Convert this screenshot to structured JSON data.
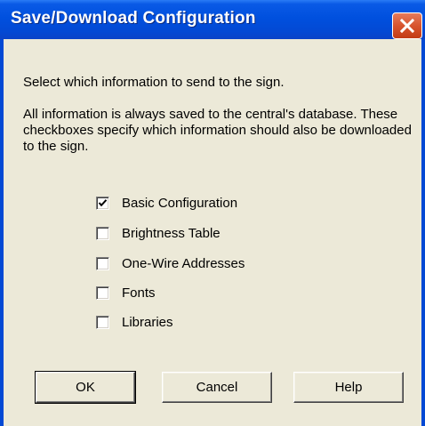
{
  "window": {
    "title": "Save/Download Configuration",
    "close_icon": "close-x-icon",
    "colors": {
      "titlebar": "#0050de",
      "face": "#ece9d8",
      "close": "#d8542e"
    }
  },
  "content": {
    "instruction": "Select which information to send to the sign.",
    "description": "All information is always saved to the central's database.  These checkboxes specify which information should also be downloaded to the sign."
  },
  "checkboxes": [
    {
      "label": "Basic Configuration",
      "checked": true
    },
    {
      "label": "Brightness Table",
      "checked": false
    },
    {
      "label": "One-Wire Addresses",
      "checked": false
    },
    {
      "label": "Fonts",
      "checked": false
    },
    {
      "label": "Libraries",
      "checked": false
    }
  ],
  "buttons": {
    "ok": "OK",
    "cancel": "Cancel",
    "help": "Help"
  }
}
